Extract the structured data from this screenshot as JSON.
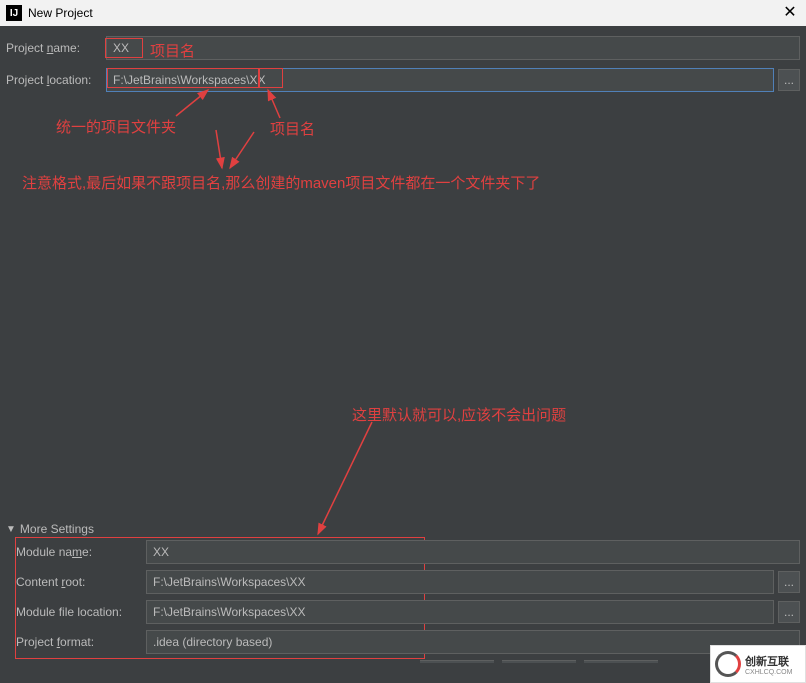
{
  "titlebar": {
    "title": "New Project",
    "icon_label": "IJ"
  },
  "fields": {
    "project_name_label": "Project name:",
    "project_name_value": "XX",
    "project_location_label": "Project location:",
    "project_location_value": "F:\\JetBrains\\Workspaces\\XX",
    "browse_label": "..."
  },
  "annotations": {
    "name_label": "项目名",
    "folder_label": "统一的项目文件夹",
    "suffix_label": "项目名",
    "note_line": "注意格式,最后如果不跟项目名,那么创建的maven项目文件都在一个文件夹下了",
    "default_note": "这里默认就可以,应该不会出问题"
  },
  "more_settings": {
    "header": "More Settings",
    "module_name_label": "Module name:",
    "module_name_value": "XX",
    "content_root_label": "Content root:",
    "content_root_value": "F:\\JetBrains\\Workspaces\\XX",
    "module_file_location_label": "Module file location:",
    "module_file_location_value": "F:\\JetBrains\\Workspaces\\XX",
    "project_format_label": "Project format:",
    "project_format_value": ".idea (directory based)",
    "browse_label": "..."
  },
  "watermark": {
    "line1": "创新互联",
    "line2": "CXHLCQ.COM"
  },
  "colors": {
    "annotation_red": "#e04040",
    "bg": "#3c3f41",
    "input_bg": "#45494a",
    "highlight_border": "#5080b8"
  }
}
